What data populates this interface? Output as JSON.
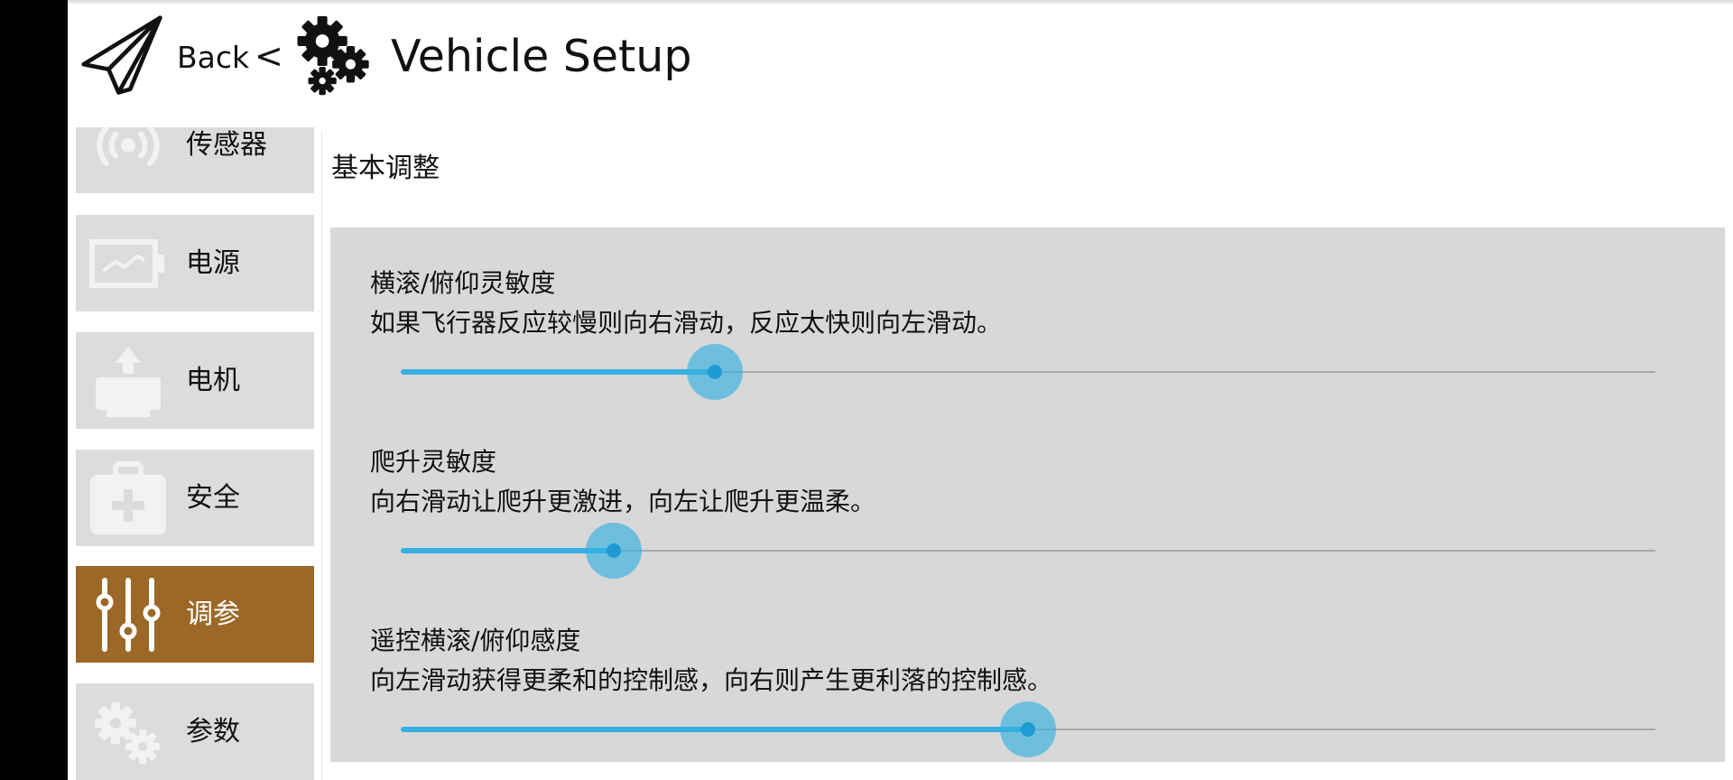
{
  "header": {
    "back_label": "Back",
    "separator": "<",
    "title": "Vehicle Setup",
    "icons": {
      "back": "paper-plane-icon",
      "title": "gears-icon"
    }
  },
  "sidebar": {
    "items": [
      {
        "label": "传感器",
        "icon": "sensor-icon",
        "active": false
      },
      {
        "label": "电源",
        "icon": "battery-icon",
        "active": false
      },
      {
        "label": "电机",
        "icon": "motor-icon",
        "active": false
      },
      {
        "label": "安全",
        "icon": "safety-kit-icon",
        "active": false
      },
      {
        "label": "调参",
        "icon": "sliders-icon",
        "active": true
      },
      {
        "label": "参数",
        "icon": "gears-icon",
        "active": false
      }
    ]
  },
  "main": {
    "section_title": "基本调整",
    "settings": [
      {
        "title": "横滚/俯仰灵敏度",
        "description": "如果飞行器反应较慢则向右滑动，反应太快则向左滑动。",
        "value_fraction": 0.25
      },
      {
        "title": "爬升灵敏度",
        "description": "向右滑动让爬升更激进，向左让爬升更温柔。",
        "value_fraction": 0.17
      },
      {
        "title": "遥控横滚/俯仰感度",
        "description": "向左滑动获得更柔和的控制感，向右则产生更利落的控制感。",
        "value_fraction": 0.5
      }
    ]
  },
  "colors": {
    "accent": "#35b0e2",
    "active_tab": "#9b6827",
    "panel_bg": "#d8d8d8",
    "sidebar_bg": "#dcdcdc"
  }
}
